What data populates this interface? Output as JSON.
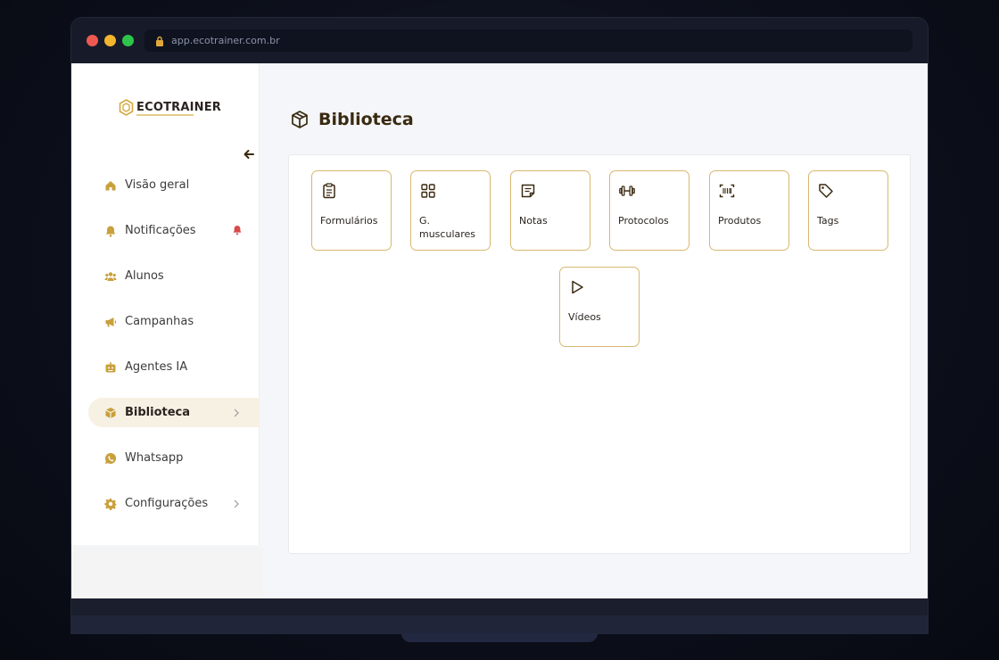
{
  "browser": {
    "url": "app.ecotrainer.com.br"
  },
  "sidebar": {
    "logo_text": "ECOTRAINER",
    "items": [
      {
        "label": "Visão geral",
        "icon": "home-icon"
      },
      {
        "label": "Notificações",
        "icon": "bell-icon",
        "badge": "alert-bell-icon"
      },
      {
        "label": "Alunos",
        "icon": "users-icon"
      },
      {
        "label": "Campanhas",
        "icon": "megaphone-icon"
      },
      {
        "label": "Agentes IA",
        "icon": "robot-icon"
      },
      {
        "label": "Biblioteca",
        "icon": "box-icon",
        "active": true,
        "chevron": true
      },
      {
        "label": "Whatsapp",
        "icon": "whatsapp-icon"
      },
      {
        "label": "Configurações",
        "icon": "gear-icon",
        "chevron": true
      }
    ]
  },
  "main": {
    "title": "Biblioteca",
    "tiles": [
      {
        "label": "Formulários",
        "icon": "clipboard-icon"
      },
      {
        "label": "G. musculares",
        "icon": "grid-icon"
      },
      {
        "label": "Notas",
        "icon": "note-icon"
      },
      {
        "label": "Protocolos",
        "icon": "dumbbell-icon"
      },
      {
        "label": "Produtos",
        "icon": "barcode-icon"
      },
      {
        "label": "Tags",
        "icon": "tag-icon"
      },
      {
        "label": "Vídeos",
        "icon": "play-icon"
      }
    ]
  },
  "colors": {
    "accent": "#c9a03c",
    "accent_light": "#f7f1e4",
    "tile_border": "#d8b870",
    "title": "#3a2a10",
    "alert": "#d94a4a"
  }
}
